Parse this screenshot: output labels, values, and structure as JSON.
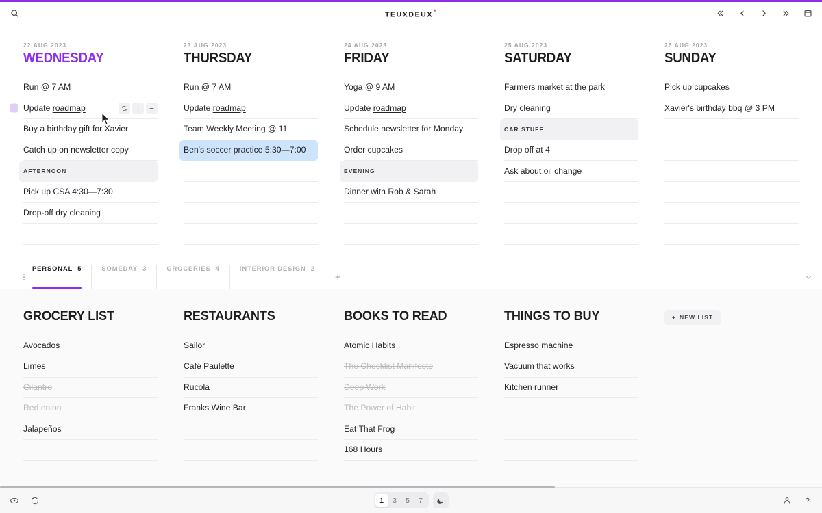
{
  "app": {
    "brand": "TEUXDEUX",
    "brand_star": "*",
    "accent": "#8b2fe8",
    "highlight": "#cde4fb"
  },
  "topbar": {
    "search_icon": "search-icon",
    "nav": [
      {
        "name": "jump-back-icon",
        "glyph": "«"
      },
      {
        "name": "prev-icon",
        "glyph": "‹"
      },
      {
        "name": "next-icon",
        "glyph": "›"
      },
      {
        "name": "jump-forward-icon",
        "glyph": "»"
      }
    ],
    "calendar_icon": "calendar-icon"
  },
  "calendar": {
    "days": [
      {
        "date": "22 AUG 2023",
        "name": "WEDNESDAY",
        "today": true,
        "todos": [
          {
            "text": "Run @ 7 AM",
            "type": "item"
          },
          {
            "text": "Update roadmap",
            "type": "item",
            "underline": "roadmap",
            "hovered": true,
            "actions": [
              "repeat-icon",
              "more-options-icon",
              "delete-icon"
            ]
          },
          {
            "text": "Buy a birthday gift for Xavier",
            "type": "item"
          },
          {
            "text": "Catch up on newsletter copy",
            "type": "item"
          },
          {
            "text": "AFTERNOON",
            "type": "header"
          },
          {
            "text": "Pick up CSA 4:30—7:30",
            "type": "item"
          },
          {
            "text": "Drop-off dry cleaning",
            "type": "item"
          },
          {
            "text": "",
            "type": "blank"
          },
          {
            "text": "",
            "type": "blank"
          }
        ]
      },
      {
        "date": "23 AUG 2023",
        "name": "THURSDAY",
        "today": false,
        "todos": [
          {
            "text": "Run @ 7 AM",
            "type": "item"
          },
          {
            "text": "Update roadmap",
            "type": "item",
            "underline": "roadmap"
          },
          {
            "text": "Team Weekly Meeting @ 11",
            "type": "item"
          },
          {
            "text": "Ben's soccer practice 5:30—7:00",
            "type": "highlight"
          },
          {
            "text": "",
            "type": "blank"
          },
          {
            "text": "",
            "type": "blank"
          },
          {
            "text": "",
            "type": "blank"
          },
          {
            "text": "",
            "type": "blank"
          },
          {
            "text": "",
            "type": "blank"
          }
        ]
      },
      {
        "date": "24 AUG 2023",
        "name": "FRIDAY",
        "today": false,
        "todos": [
          {
            "text": "Yoga @ 9 AM",
            "type": "item"
          },
          {
            "text": "Update roadmap",
            "type": "item",
            "underline": "roadmap"
          },
          {
            "text": "Schedule newsletter for Monday",
            "type": "item"
          },
          {
            "text": "Order cupcakes",
            "type": "item"
          },
          {
            "text": "EVENING",
            "type": "header"
          },
          {
            "text": "Dinner with Rob & Sarah",
            "type": "item"
          },
          {
            "text": "",
            "type": "blank"
          },
          {
            "text": "",
            "type": "blank"
          },
          {
            "text": "",
            "type": "blank"
          }
        ]
      },
      {
        "date": "25 AUG 2023",
        "name": "SATURDAY",
        "today": false,
        "todos": [
          {
            "text": "Farmers market at the park",
            "type": "item"
          },
          {
            "text": "Dry cleaning",
            "type": "item"
          },
          {
            "text": "CAR STUFF",
            "type": "header"
          },
          {
            "text": "Drop off at 4",
            "type": "item"
          },
          {
            "text": "Ask about oil change",
            "type": "item"
          },
          {
            "text": "",
            "type": "blank"
          },
          {
            "text": "",
            "type": "blank"
          },
          {
            "text": "",
            "type": "blank"
          },
          {
            "text": "",
            "type": "blank"
          }
        ]
      },
      {
        "date": "26 AUG 2023",
        "name": "SUNDAY",
        "today": false,
        "todos": [
          {
            "text": "Pick up cupcakes",
            "type": "item"
          },
          {
            "text": "Xavier's birthday bbq @ 3 PM",
            "type": "item"
          },
          {
            "text": "",
            "type": "blank"
          },
          {
            "text": "",
            "type": "blank"
          },
          {
            "text": "",
            "type": "blank"
          },
          {
            "text": "",
            "type": "blank"
          },
          {
            "text": "",
            "type": "blank"
          },
          {
            "text": "",
            "type": "blank"
          },
          {
            "text": "",
            "type": "blank"
          }
        ]
      }
    ]
  },
  "tabs": {
    "items": [
      {
        "label": "PERSONAL",
        "count": "5",
        "active": true
      },
      {
        "label": "SOMEDAY",
        "count": "3",
        "active": false
      },
      {
        "label": "GROCERIES",
        "count": "4",
        "active": false
      },
      {
        "label": "INTERIOR DESIGN",
        "count": "2",
        "active": false
      }
    ],
    "add_label": "+",
    "collapse_icon": "chevron-down-icon",
    "grip_icon": "drag-grip-icon"
  },
  "lists": {
    "columns": [
      {
        "title": "GROCERY LIST",
        "items": [
          {
            "text": "Avocados",
            "done": false
          },
          {
            "text": "Limes",
            "done": false
          },
          {
            "text": "Cilantro",
            "done": true
          },
          {
            "text": "Red onion",
            "done": true
          },
          {
            "text": "Jalapeños",
            "done": false
          },
          {
            "text": "",
            "done": false
          },
          {
            "text": "",
            "done": false
          }
        ]
      },
      {
        "title": "RESTAURANTS",
        "items": [
          {
            "text": "Sailor",
            "done": false
          },
          {
            "text": "Café Paulette",
            "done": false
          },
          {
            "text": "Rucola",
            "done": false
          },
          {
            "text": "Franks Wine Bar",
            "done": false
          },
          {
            "text": "",
            "done": false
          },
          {
            "text": "",
            "done": false
          },
          {
            "text": "",
            "done": false
          }
        ]
      },
      {
        "title": "BOOKS TO READ",
        "items": [
          {
            "text": "Atomic Habits",
            "done": false
          },
          {
            "text": "The Checklist Manifesto",
            "done": true
          },
          {
            "text": "Deep Work",
            "done": true
          },
          {
            "text": "The Power of Habit",
            "done": true
          },
          {
            "text": "Eat That Frog",
            "done": false
          },
          {
            "text": "168 Hours",
            "done": false
          },
          {
            "text": "",
            "done": false
          }
        ]
      },
      {
        "title": "THINGS TO BUY",
        "items": [
          {
            "text": "Espresso machine",
            "done": false
          },
          {
            "text": "Vacuum that works",
            "done": false
          },
          {
            "text": "Kitchen runner",
            "done": false
          },
          {
            "text": "",
            "done": false
          },
          {
            "text": "",
            "done": false
          },
          {
            "text": "",
            "done": false
          },
          {
            "text": "",
            "done": false
          }
        ]
      }
    ],
    "new_list_label": "NEW LIST"
  },
  "bottombar": {
    "left_icons": [
      {
        "name": "visibility-eye-icon"
      },
      {
        "name": "sync-icon"
      }
    ],
    "day_counts": [
      {
        "label": "1",
        "selected": true
      },
      {
        "label": "3",
        "selected": false
      },
      {
        "label": "5",
        "selected": false
      },
      {
        "label": "7",
        "selected": false
      }
    ],
    "dark_mode_icon": "moon-icon",
    "right_icons": [
      {
        "name": "account-icon"
      },
      {
        "name": "help-icon"
      }
    ]
  }
}
